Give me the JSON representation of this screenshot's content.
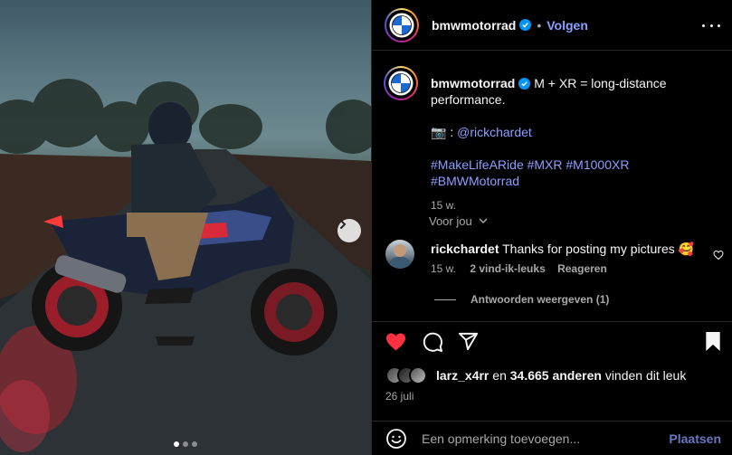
{
  "post": {
    "username": "bmwmotorrad",
    "follow_label": "Volgen",
    "separator": "•"
  },
  "caption": {
    "username": "bmwmotorrad",
    "text": "M + XR = long-distance performance.",
    "credit_prefix": "📷 :",
    "credit_user": "@rickchardet",
    "hashtags": "#MakeLifeARide #MXR #M1000XR #BMWMotorrad",
    "age": "15 w."
  },
  "for_you": {
    "label": "Voor jou"
  },
  "comment": {
    "username": "rickchardet",
    "text": "Thanks for posting my pictures",
    "emoji": "🥰",
    "age": "15 w.",
    "likes": "2 vind-ik-leuks",
    "reply_label": "Reageren",
    "view_replies": "Antwoorden weergeven (1)"
  },
  "likes": {
    "user": "larz_x4rr",
    "connector": "en",
    "count": "34.665 anderen",
    "suffix": "vinden dit leuk",
    "date": "26 juli"
  },
  "add_comment": {
    "placeholder": "Een opmerking toevoegen...",
    "post_label": "Plaatsen"
  },
  "carousel": {
    "total": 3,
    "active": 1
  },
  "colors": {
    "accent": "#8c9eff",
    "like": "#ff3040",
    "verified": "#0095f6"
  },
  "icons": [
    "bmw-logo-icon",
    "verified-icon",
    "more-options-icon",
    "chevron-down-icon",
    "heart-outline-icon",
    "heart-filled-icon",
    "comment-icon",
    "share-icon",
    "bookmark-icon",
    "emoji-icon",
    "chevron-right-icon"
  ]
}
